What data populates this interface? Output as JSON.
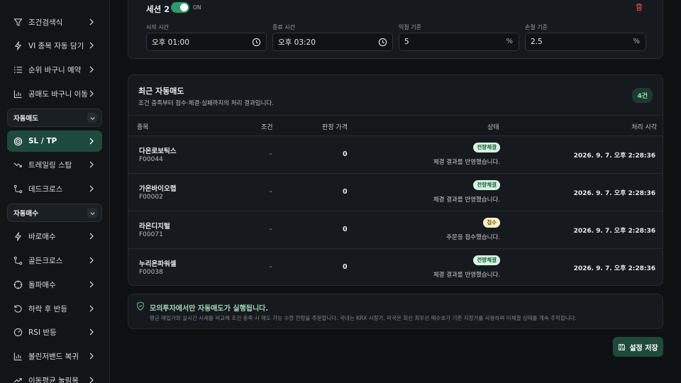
{
  "sidebar": {
    "items_top": [
      {
        "label": "조건검색식",
        "icon": "filter-icon"
      },
      {
        "label": "VI 종목 자동 담기",
        "icon": "lightning-icon"
      },
      {
        "label": "순위 바구니 예약",
        "icon": "ranked-list-icon"
      },
      {
        "label": "공매도 바구니 이동",
        "icon": "bar-chart-icon"
      }
    ],
    "group_auto_sell": "자동매도",
    "items_sell": [
      {
        "label": "SL / TP",
        "icon": "target-icon"
      },
      {
        "label": "트레일링 스탑",
        "icon": "trend-down-icon"
      },
      {
        "label": "데드크로스",
        "icon": "cross-path-icon"
      }
    ],
    "group_auto_buy": "자동매수",
    "items_buy": [
      {
        "label": "바로매수",
        "icon": "lightning-icon"
      },
      {
        "label": "골든크로스",
        "icon": "cross-path-icon"
      },
      {
        "label": "돌파매수",
        "icon": "crosshair-icon"
      },
      {
        "label": "하락 후 반등",
        "icon": "rotate-icon"
      },
      {
        "label": "RSI 반등",
        "icon": "gauge-icon"
      },
      {
        "label": "볼린저밴드 복귀",
        "icon": "bar-chart-icon"
      },
      {
        "label": "이동평균 눌림목",
        "icon": "trend-up-icon"
      }
    ]
  },
  "session": {
    "title": "세션 2",
    "toggle_text": "ON",
    "start_label": "시작 시간",
    "start_value": "오후 01:00",
    "end_label": "종료 시간",
    "end_value": "오후 03:20",
    "tp_label": "익절 기준",
    "tp_value": "5",
    "sl_label": "손절 기준",
    "sl_value": "2.5",
    "percent": "%"
  },
  "recent": {
    "title": "최근 자동매도",
    "subtitle": "조건 충족부터 접수·체결·실패까지의 처리 결과입니다.",
    "count": "4건",
    "columns": [
      "종목",
      "조건",
      "판정 가격",
      "상태",
      "처리 시각"
    ],
    "rows": [
      {
        "name": "다온로보틱스",
        "code": "F00044",
        "cond": "-",
        "price": "0",
        "badge": "전량체결",
        "kind": "fill",
        "msg": "체결 결과를 반영했습니다.",
        "time": "2026. 9. 7. 오후 2:28:36"
      },
      {
        "name": "가온바이오랩",
        "code": "F00002",
        "cond": "-",
        "price": "0",
        "badge": "전량체결",
        "kind": "fill",
        "msg": "체결 결과를 반영했습니다.",
        "time": "2026. 9. 7. 오후 2:28:36"
      },
      {
        "name": "라온디지털",
        "code": "F00071",
        "cond": "-",
        "price": "0",
        "badge": "접수",
        "kind": "rcv",
        "msg": "주문을 접수했습니다.",
        "time": "2026. 9. 7. 오후 2:28:36"
      },
      {
        "name": "누리온파워셀",
        "code": "F00038",
        "cond": "-",
        "price": "0",
        "badge": "전량체결",
        "kind": "fill",
        "msg": "체결 결과를 반영했습니다.",
        "time": "2026. 9. 7. 오후 2:28:36"
      }
    ]
  },
  "notice": {
    "title": "모의투자에서만 자동매도가 실행됩니다.",
    "body": "평균 매입가와 실시간 시세를 비교해 조건 충족 시 매도 가능 수량 전량을 주문합니다. 국내는 KRX 시장가, 미국은 최신 최우선 매수호가 기준 지정가를 사용하며 미체결 상태를 계속 추적합니다."
  },
  "save_label": "설정 저장",
  "colors": {
    "accent": "#1e4a3c",
    "toggle_on": "#2f9a6e",
    "danger": "#e0564f"
  }
}
